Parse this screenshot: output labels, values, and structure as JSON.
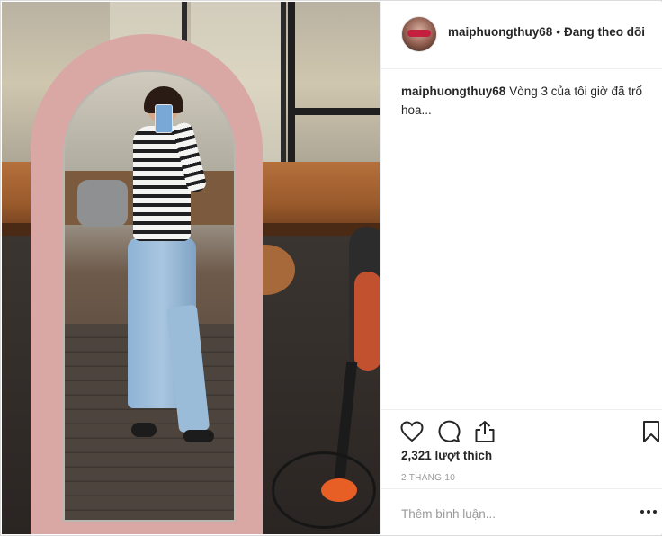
{
  "post": {
    "username": "maiphuongthuy68",
    "separator": "•",
    "follow_status": "Đang theo dõi",
    "caption_user": "maiphuongthuy68",
    "caption_text": "Vòng 3 của tôi giờ đã trổ hoa..."
  },
  "actions": {
    "like_icon": "heart-icon",
    "comment_icon": "comment-bubble-icon",
    "share_icon": "share-upload-icon",
    "save_icon": "bookmark-icon"
  },
  "stats": {
    "likes_text": "2,321 lượt thích",
    "date_text": "2 THÁNG 10"
  },
  "comment": {
    "placeholder": "Thêm bình luận...",
    "more_icon": "ellipsis-icon"
  },
  "colors": {
    "text": "#262626",
    "muted": "#999999",
    "divider": "#efefef",
    "mirror_frame": "#d9a8a5"
  }
}
